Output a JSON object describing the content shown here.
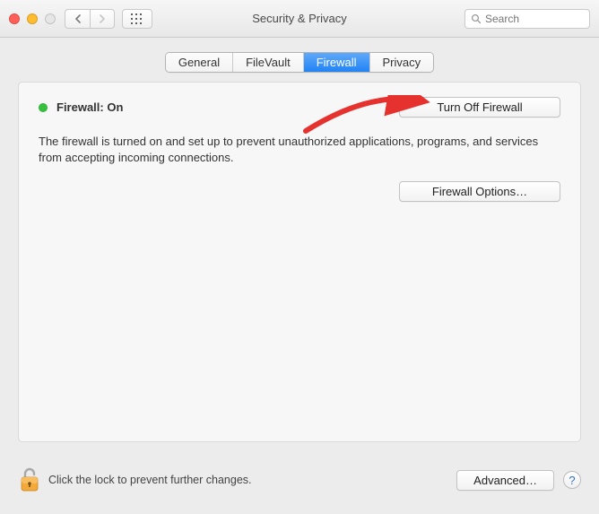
{
  "window": {
    "title": "Security & Privacy"
  },
  "search": {
    "placeholder": "Search"
  },
  "tabs": {
    "general": "General",
    "filevault": "FileVault",
    "firewall": "Firewall",
    "privacy": "Privacy",
    "active": "firewall"
  },
  "firewall": {
    "status_label": "Firewall: On",
    "status_color": "#35c13d",
    "toggle_button": "Turn Off Firewall",
    "description": "The firewall is turned on and set up to prevent unauthorized applications, programs, and services from accepting incoming connections.",
    "options_button": "Firewall Options…"
  },
  "footer": {
    "lock_text": "Click the lock to prevent further changes.",
    "advanced_button": "Advanced…",
    "help_label": "?"
  }
}
